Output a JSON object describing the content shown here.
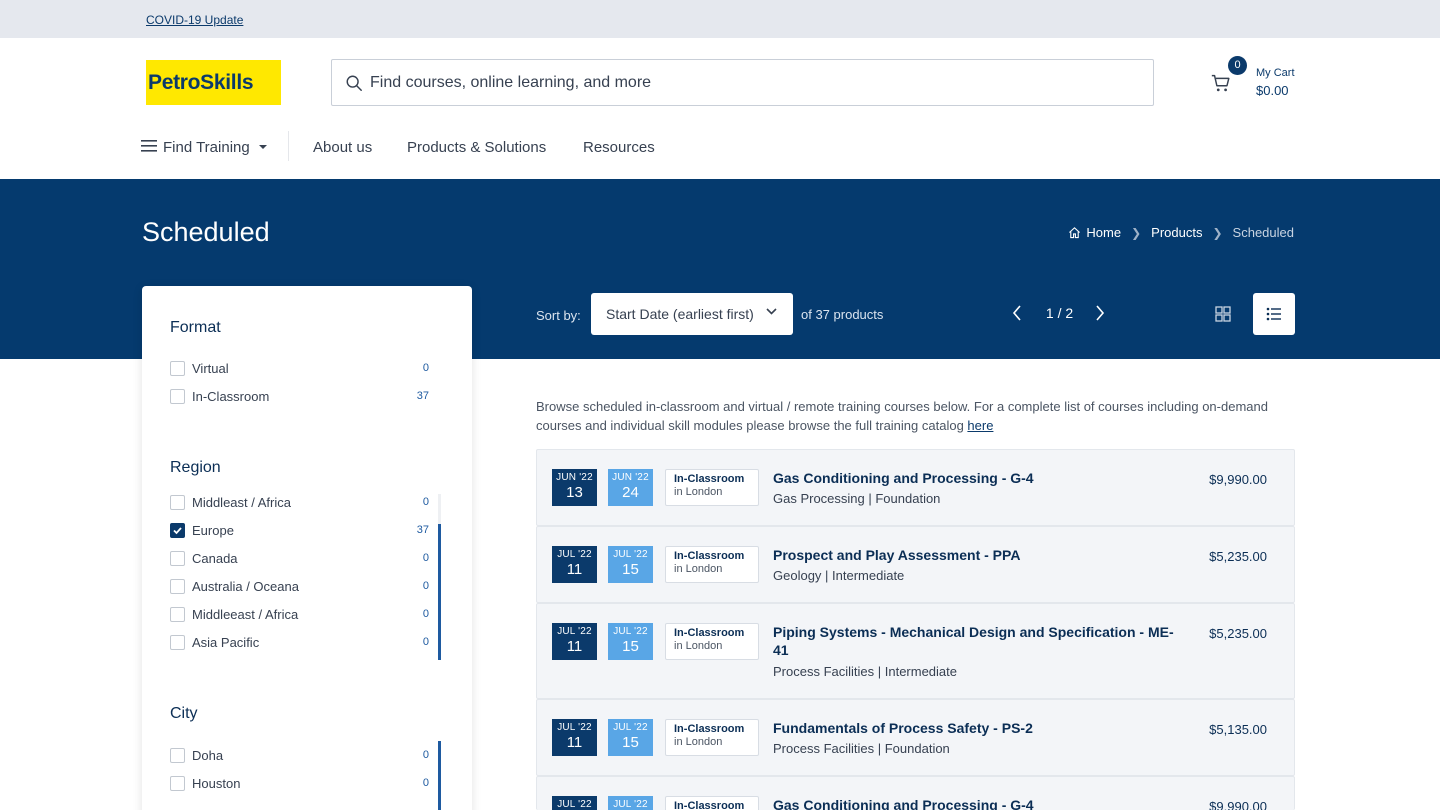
{
  "topbar": {
    "covid_link": "COVID-19 Update"
  },
  "logo": {
    "text": "PetroSkills"
  },
  "search": {
    "placeholder": "Find courses, online learning, and more"
  },
  "cart": {
    "count": "0",
    "label": "My Cart",
    "total": "$0.00"
  },
  "nav": {
    "find_training": "Find Training",
    "about": "About us",
    "products": "Products & Solutions",
    "resources": "Resources"
  },
  "hero": {
    "title": "Scheduled",
    "breadcrumb": [
      "Home",
      "Products",
      "Scheduled"
    ]
  },
  "toolbar": {
    "sort_label": "Sort by:",
    "sort_value": "Start Date (earliest first)",
    "count_text": "of 37 products",
    "page": "1 / 2"
  },
  "filters": {
    "format": {
      "title": "Format",
      "items": [
        {
          "label": "Virtual",
          "count": "0",
          "checked": false
        },
        {
          "label": "In-Classroom",
          "count": "37",
          "checked": false
        }
      ]
    },
    "region": {
      "title": "Region",
      "items": [
        {
          "label": "Middleast / Africa",
          "count": "0",
          "checked": false
        },
        {
          "label": "Europe",
          "count": "37",
          "checked": true
        },
        {
          "label": "Canada",
          "count": "0",
          "checked": false
        },
        {
          "label": "Australia / Oceana",
          "count": "0",
          "checked": false
        },
        {
          "label": "Middleeast / Africa",
          "count": "0",
          "checked": false
        },
        {
          "label": "Asia Pacific",
          "count": "0",
          "checked": false
        }
      ]
    },
    "city": {
      "title": "City",
      "items": [
        {
          "label": "Doha",
          "count": "0",
          "checked": false
        },
        {
          "label": "Houston",
          "count": "0",
          "checked": false
        }
      ]
    }
  },
  "intro": {
    "text": "Browse scheduled in-classroom and virtual / remote training courses below. For a complete list of courses including on-demand courses and individual skill modules please browse the full training catalog ",
    "link": "here"
  },
  "courses": [
    {
      "start_my": "JUN  '22",
      "start_d": "13",
      "end_my": "JUN  '22",
      "end_d": "24",
      "format": "In-Classroom",
      "location": "in London",
      "title": "Gas Conditioning and Processing - G-4",
      "sub": "Gas Processing | Foundation",
      "price": "$9,990.00"
    },
    {
      "start_my": "JUL  '22",
      "start_d": "11",
      "end_my": "JUL  '22",
      "end_d": "15",
      "format": "In-Classroom",
      "location": "in London",
      "title": "Prospect and Play Assessment - PPA",
      "sub": "Geology | Intermediate",
      "price": "$5,235.00"
    },
    {
      "start_my": "JUL  '22",
      "start_d": "11",
      "end_my": "JUL  '22",
      "end_d": "15",
      "format": "In-Classroom",
      "location": "in London",
      "title": "Piping Systems - Mechanical Design and Specification - ME-41",
      "sub": "Process Facilities | Intermediate",
      "price": "$5,235.00"
    },
    {
      "start_my": "JUL  '22",
      "start_d": "11",
      "end_my": "JUL  '22",
      "end_d": "15",
      "format": "In-Classroom",
      "location": "in London",
      "title": "Fundamentals of Process Safety - PS-2",
      "sub": "Process Facilities | Foundation",
      "price": "$5,135.00"
    },
    {
      "start_my": "JUL  '22",
      "start_d": "",
      "end_my": "JUL  '22",
      "end_d": "",
      "format": "In-Classroom",
      "location": "",
      "title": "Gas Conditioning and Processing - G-4",
      "sub": "",
      "price": "$9,990.00"
    }
  ]
}
